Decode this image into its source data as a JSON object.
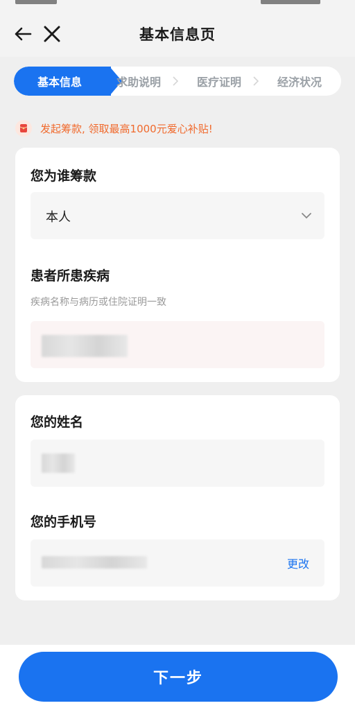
{
  "header": {
    "title": "基本信息页",
    "back_icon": "arrow-left-icon",
    "close_icon": "close-icon"
  },
  "steps": {
    "active": "基本信息",
    "items": [
      "求助说明",
      "医疗证明",
      "经济状况"
    ]
  },
  "notice": {
    "icon": "red-envelope-icon",
    "text": "发起筹款, 领取最高1000元爱心补贴!"
  },
  "form": {
    "beneficiary": {
      "label": "您为谁筹款",
      "value": "本人"
    },
    "disease": {
      "label": "患者所患疾病",
      "hint": "疾病名称与病历或住院证明一致"
    },
    "name": {
      "label": "您的姓名"
    },
    "phone": {
      "label": "您的手机号",
      "change_label": "更改"
    }
  },
  "footer": {
    "next_label": "下一步"
  },
  "colors": {
    "primary": "#1a73f0",
    "notice": "#f06a2d",
    "background": "#efefef"
  }
}
